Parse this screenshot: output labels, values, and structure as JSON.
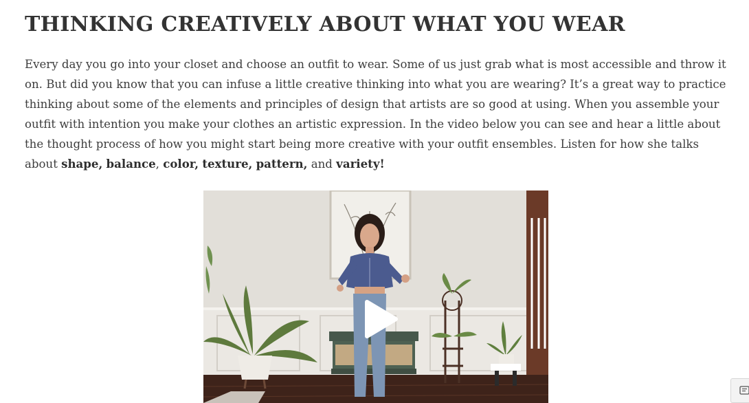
{
  "article": {
    "title": "THINKING CREATIVELY ABOUT WHAT YOU WEAR",
    "intro_text": "Every day you go into your closet and choose an outfit to wear. Some of us just grab what is most accessible and throw it on. But did you know that you can infuse a little creative thinking into what you are wearing? It’s a great way to practice thinking about some of the elements and principles of design that artists are so good at using. When you assemble your outfit with intention you make your clothes an artistic expression. In the video below you can see and hear a little about the thought process of how you might start being more creative with your outfit ensembles. Listen for how she talks about ",
    "emphasis": {
      "shape": "shape,",
      "balance": "balance",
      "color": "color,",
      "texture": "texture,",
      "pattern": "pattern,",
      "and": "and",
      "variety": "variety!"
    }
  },
  "video": {
    "play_icon": "play-icon"
  },
  "corner_widget": {
    "icon": "feedback-icon"
  }
}
